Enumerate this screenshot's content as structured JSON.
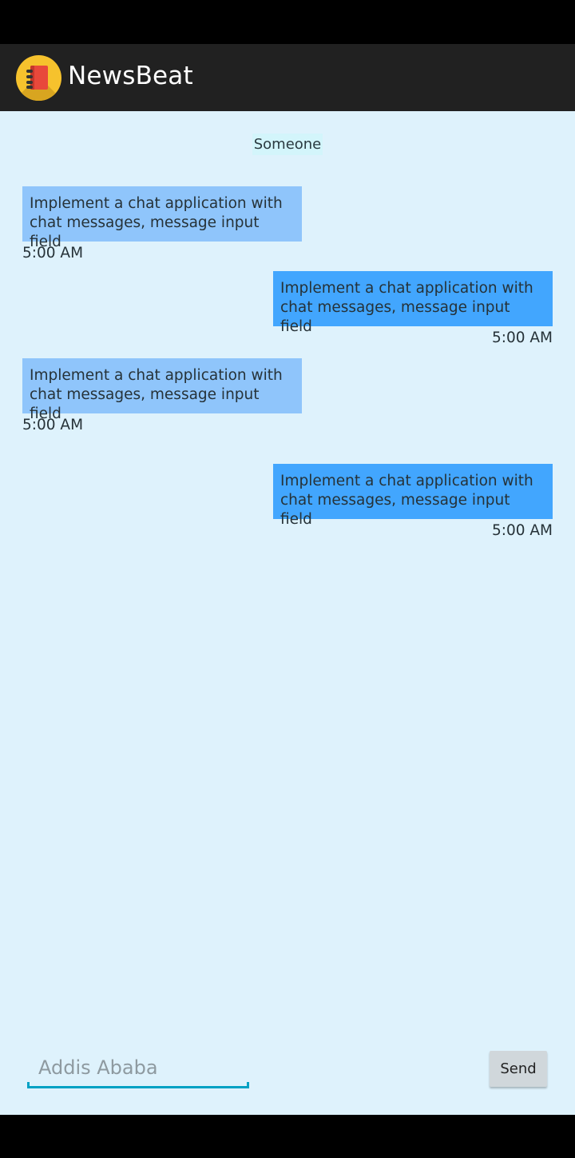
{
  "app": {
    "title": "NewsBeat"
  },
  "chat": {
    "contact_name": "Someone",
    "messages": [
      {
        "direction": "received",
        "text": "Implement a chat application with chat messages, message input field",
        "time": "5:00 AM"
      },
      {
        "direction": "sent",
        "text": "Implement a chat application with chat messages, message input field",
        "time": "5:00 AM"
      },
      {
        "direction": "received",
        "text": "Implement a chat application with chat messages, message input field",
        "time": "5:00 AM"
      },
      {
        "direction": "sent",
        "text": "Implement a chat application with chat messages, message input field",
        "time": "5:00 AM"
      }
    ]
  },
  "composer": {
    "placeholder": "Addis Ababa",
    "send_label": "Send"
  },
  "colors": {
    "app_bar": "#212121",
    "chat_background": "#def2fc",
    "received_bubble": "#8fc5fb",
    "sent_bubble": "#42a6fe",
    "input_underline": "#00a1c4"
  },
  "icons": {
    "app_logo": "notebook-icon"
  }
}
